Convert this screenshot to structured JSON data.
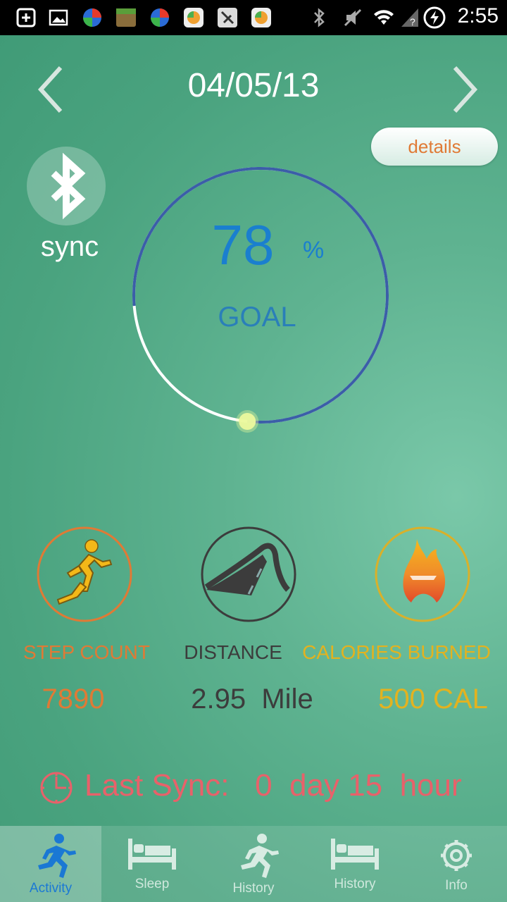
{
  "statusbar": {
    "time": "2:55"
  },
  "header": {
    "date": "04/05/13"
  },
  "details_label": "details",
  "sync": {
    "label": "sync"
  },
  "goal": {
    "value": "78",
    "unit": "%",
    "label": "GOAL",
    "progress": 0.78
  },
  "stats": {
    "steps": {
      "label": "STEP COUNT",
      "value": "7890"
    },
    "distance": {
      "label": "DISTANCE",
      "value": "2.95  Mile"
    },
    "calories": {
      "label": "CALORIES BURNED",
      "value": "500 CAL"
    }
  },
  "last_sync": {
    "text": "Last Sync:   0  day 15  hour"
  },
  "tabs": [
    {
      "label": "Activity",
      "icon": "runner-icon",
      "active": true
    },
    {
      "label": "Sleep",
      "icon": "bed-icon",
      "active": false
    },
    {
      "label": "History",
      "icon": "runner-icon",
      "active": false
    },
    {
      "label": "History",
      "icon": "bed-icon",
      "active": false
    },
    {
      "label": "Info",
      "icon": "gear-icon",
      "active": false
    }
  ],
  "colors": {
    "accent_blue": "#1a7fcf",
    "orange": "#e07a35",
    "gold": "#e3b21f",
    "dark": "#3c3c3c",
    "sync_red": "#e8616a"
  }
}
